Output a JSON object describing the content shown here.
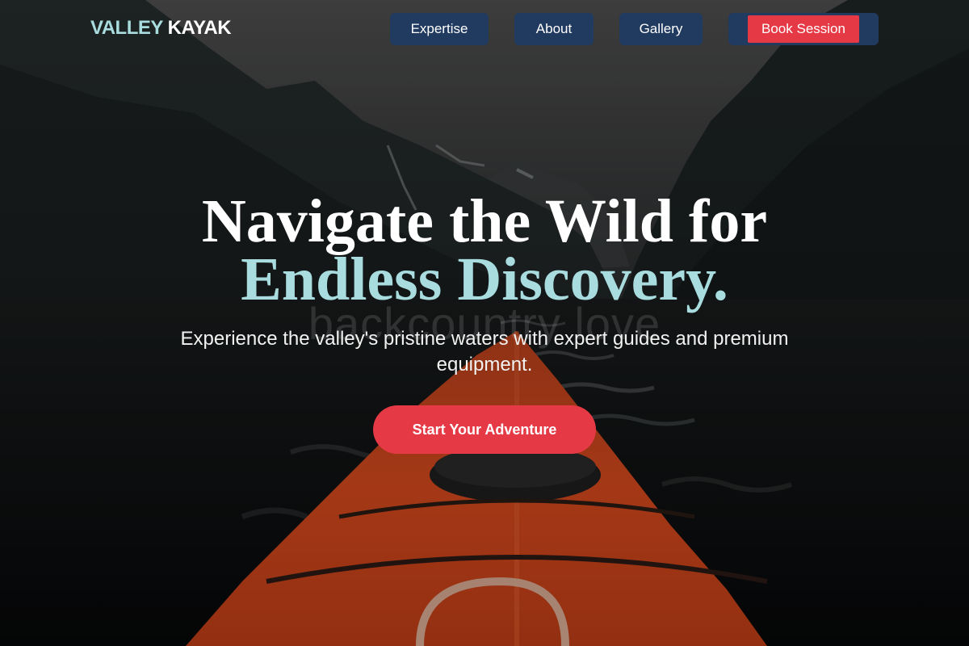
{
  "brand": {
    "part1": "VALLEY",
    "part2": "KAYAK"
  },
  "nav": {
    "items": [
      {
        "label": "Expertise"
      },
      {
        "label": "About"
      },
      {
        "label": "Gallery"
      }
    ],
    "book_label": "Book Session"
  },
  "hero": {
    "background": "kayak-bow-fjord-photo",
    "watermark": "backcountry love",
    "headline_line1": "Navigate the Wild for",
    "headline_line2": "Endless Discovery.",
    "subtext": "Experience the valley's pristine waters with expert guides and premium equipment.",
    "cta_label": "Start Your Adventure"
  },
  "colors": {
    "accent_teal": "#a8dcde",
    "nav_bg": "#213a5f",
    "cta_red": "#e63946",
    "kayak_orange": "#e0461f"
  }
}
